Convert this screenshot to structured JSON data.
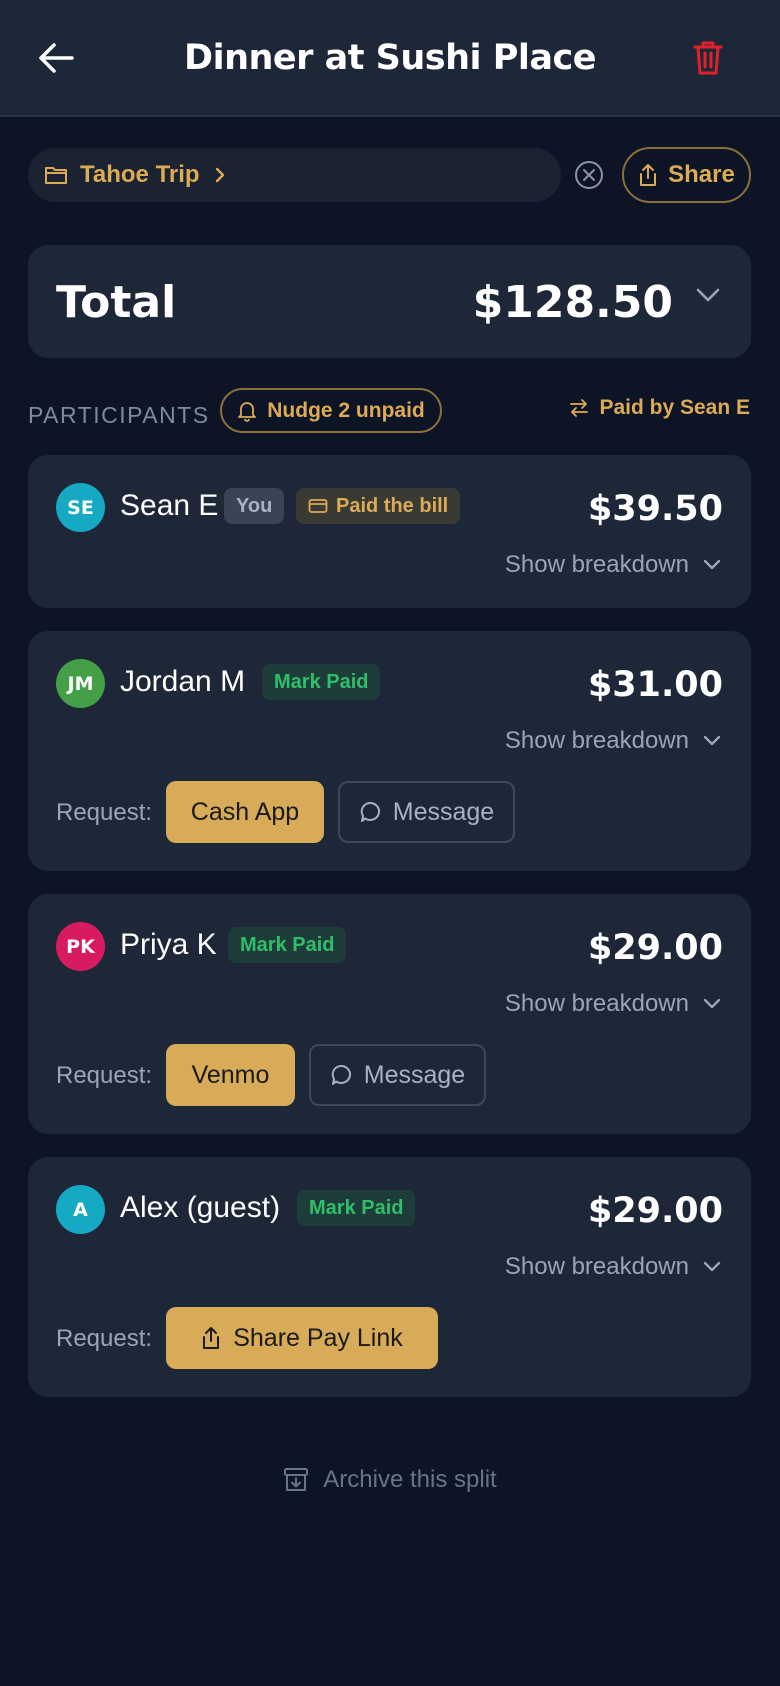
{
  "header": {
    "title": "Dinner at Sushi Place"
  },
  "group": {
    "label": "Tahoe Trip"
  },
  "share": {
    "label": "Share"
  },
  "total": {
    "label": "Total",
    "amount": "$128.50"
  },
  "participants_section": {
    "label": "PARTICIPANTS",
    "nudge_label": "Nudge 2 unpaid",
    "paid_by_label": "Paid by Sean E"
  },
  "participants": [
    {
      "initials": "SE",
      "name": "Sean E",
      "avatar_color": "#16a9c4",
      "you_tag": "You",
      "paid_tag": "Paid the bill",
      "amount": "$39.50",
      "breakdown_label": "Show breakdown"
    },
    {
      "initials": "JM",
      "name": "Jordan M",
      "avatar_color": "#43a047",
      "mark_paid": "Mark Paid",
      "amount": "$31.00",
      "breakdown_label": "Show breakdown",
      "request_label": "Request:",
      "primary_action": "Cash App",
      "secondary_action": "Message"
    },
    {
      "initials": "PK",
      "name": "Priya K",
      "avatar_color": "#d81b60",
      "mark_paid": "Mark Paid",
      "amount": "$29.00",
      "breakdown_label": "Show breakdown",
      "request_label": "Request:",
      "primary_action": "Venmo",
      "secondary_action": "Message"
    },
    {
      "initials": "A",
      "name": "Alex (guest)",
      "avatar_color": "#16a9c4",
      "mark_paid": "Mark Paid",
      "amount": "$29.00",
      "breakdown_label": "Show breakdown",
      "request_label": "Request:",
      "primary_action": "Share Pay Link"
    }
  ],
  "archive": {
    "label": "Archive this split"
  },
  "colors": {
    "accent": "#dcab55",
    "danger": "#e0202a",
    "success": "#2fbf69",
    "card": "#1e2738",
    "background": "#0c1426"
  },
  "icons": [
    "arrow-left-icon",
    "trash-icon",
    "folder-icon",
    "chevron-right-icon",
    "close-circle-icon",
    "share-icon",
    "chevron-down-icon",
    "bell-icon",
    "swap-icon",
    "card-icon",
    "message-icon",
    "archive-icon"
  ]
}
